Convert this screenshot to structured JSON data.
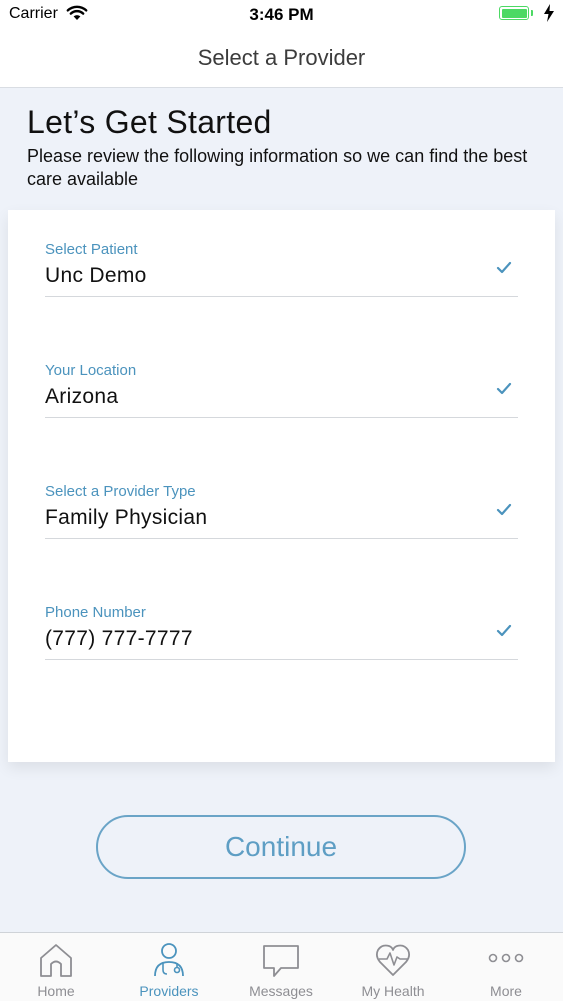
{
  "status_bar": {
    "carrier": "Carrier",
    "time": "3:46 PM"
  },
  "nav": {
    "title": "Select a Provider"
  },
  "intro": {
    "title": "Let’s Get Started",
    "subtitle": "Please review the following information so we can find the best care available"
  },
  "fields": [
    {
      "label": "Select Patient",
      "value": "Unc Demo"
    },
    {
      "label": "Your Location",
      "value": "Arizona"
    },
    {
      "label": "Select a Provider Type",
      "value": "Family Physician"
    },
    {
      "label": "Phone Number",
      "value": "(777) 777-7777"
    }
  ],
  "continue_label": "Continue",
  "tabs": [
    {
      "label": "Home",
      "icon": "home-icon"
    },
    {
      "label": "Providers",
      "icon": "provider-icon"
    },
    {
      "label": "Messages",
      "icon": "chat-bubble-icon"
    },
    {
      "label": "My Health",
      "icon": "heart-pulse-icon"
    },
    {
      "label": "More",
      "icon": "more-dots-icon"
    }
  ],
  "colors": {
    "accent": "#4b93bd",
    "battery": "#4cd964",
    "inactive": "#8e8e93"
  }
}
